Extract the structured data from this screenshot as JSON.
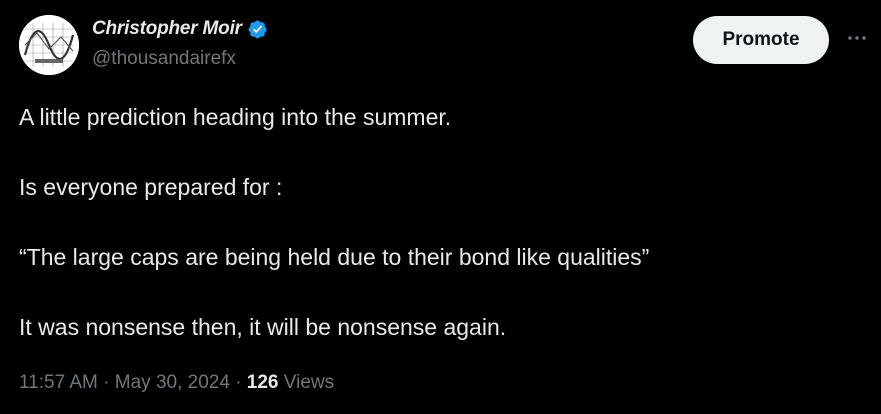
{
  "author": {
    "name": "Christopher Moir",
    "handle": "@thousandairefx",
    "verified": true,
    "verified_color": "#1d9bf0"
  },
  "actions": {
    "promote_label": "Promote",
    "more_icon": "more-horizontal-icon"
  },
  "tweet": {
    "paragraphs": [
      "A little prediction heading into the summer.",
      "Is everyone prepared for :",
      "“The large caps are being held due to their bond like qualities”",
      "It was nonsense then, it will be nonsense again."
    ]
  },
  "meta": {
    "time": "11:57 AM",
    "separator": "·",
    "date": "May 30, 2024",
    "views_count": "126",
    "views_label": "Views"
  },
  "colors": {
    "background": "#000000",
    "text": "#e7e9ea",
    "secondary": "#71767b",
    "button_bg": "#eff3f4"
  }
}
